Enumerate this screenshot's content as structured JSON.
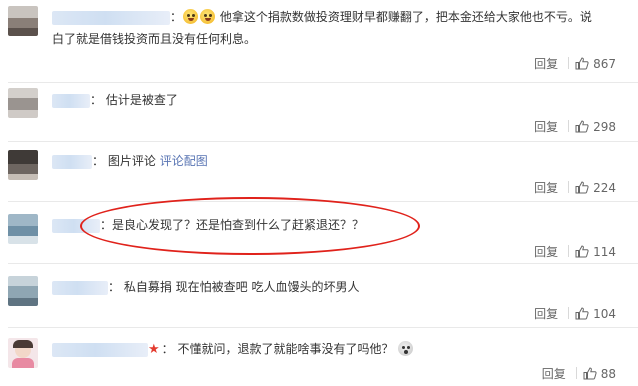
{
  "comments": [
    {
      "text_line1": "他拿这个捐款数做投资理财早都赚翻了，把本金还给大家他也不亏。说",
      "text_line2": "白了就是借钱投资而且没有任何利息。",
      "reply_label": "回复",
      "likes": "867",
      "emojis": [
        "smile-emoji",
        "smile-emoji"
      ]
    },
    {
      "text": "估计是被查了",
      "reply_label": "回复",
      "likes": "298"
    },
    {
      "text": "图片评论",
      "link_text": "评论配图",
      "reply_label": "回复",
      "likes": "224"
    },
    {
      "text": "是良心发现了？还是怕查到什么了赶紧退还？？",
      "reply_label": "回复",
      "likes": "114"
    },
    {
      "text": "私自募捐 现在怕被查吧 吃人血馒头的坏男人",
      "reply_label": "回复",
      "likes": "104"
    },
    {
      "text": "不懂就问，退款了就能啥事没有了吗他？",
      "reply_label": "回复",
      "likes": "88",
      "badge_icon": "star-badge-icon",
      "emojis": [
        "scream-emoji"
      ]
    }
  ],
  "colors": {
    "highlight_oval": "#e0221b",
    "link": "#5874b3",
    "badge": "#e33b2f"
  }
}
